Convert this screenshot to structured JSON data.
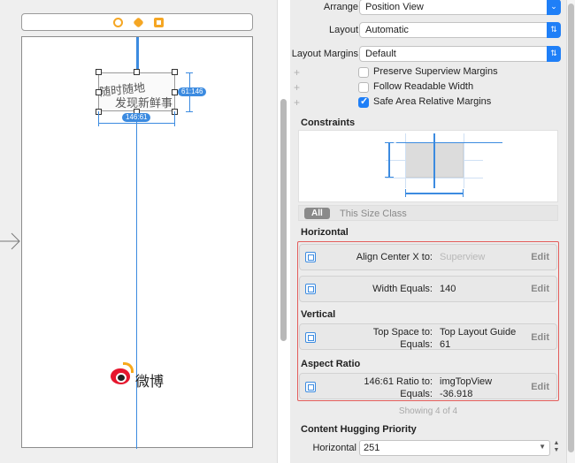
{
  "canvas": {
    "scene_icons": [
      "view-controller-icon",
      "first-responder-icon",
      "exit-icon"
    ],
    "image_view": {
      "slogan_line1": "随时随地",
      "slogan_line2": "发现新鲜事",
      "badge_height": "61:146",
      "badge_width": "146:61"
    },
    "logo_text": "微博"
  },
  "inspector": {
    "arrange": {
      "label": "Arrange",
      "value": "Position View"
    },
    "layout": {
      "label": "Layout",
      "value": "Automatic"
    },
    "layout_margins": {
      "label": "Layout Margins",
      "value": "Default"
    },
    "checks": [
      {
        "label": "Preserve Superview Margins",
        "checked": false
      },
      {
        "label": "Follow Readable Width",
        "checked": false
      },
      {
        "label": "Safe Area Relative Margins",
        "checked": true
      }
    ],
    "constraints_title": "Constraints",
    "size_class_tabs": {
      "all": "All",
      "this": "This Size Class"
    },
    "sections": {
      "horizontal": "Horizontal",
      "vertical": "Vertical",
      "aspect": "Aspect Ratio"
    },
    "constraints": {
      "align_center_x": {
        "label": "Align Center X to:",
        "value": "Superview",
        "edit": "Edit"
      },
      "width": {
        "label": "Width Equals:",
        "value": "140",
        "edit": "Edit"
      },
      "top_space": {
        "label1": "Top Space to:",
        "value1": "Top Layout Guide",
        "label2": "Equals:",
        "value2": "61",
        "edit": "Edit"
      },
      "ratio": {
        "label1": "146:61 Ratio to:",
        "value1": "imgTopView",
        "label2": "Equals:",
        "value2": "-36.918",
        "edit": "Edit"
      }
    },
    "showing": "Showing 4 of 4",
    "hugging": {
      "title": "Content Hugging Priority",
      "horizontal_label": "Horizontal",
      "horizontal_value": "251"
    }
  },
  "colors": {
    "accent": "#1f7ff7",
    "constraint_blue": "#3c8be0",
    "highlight_red": "#e35d5b",
    "scene_orange": "#f5a623"
  }
}
